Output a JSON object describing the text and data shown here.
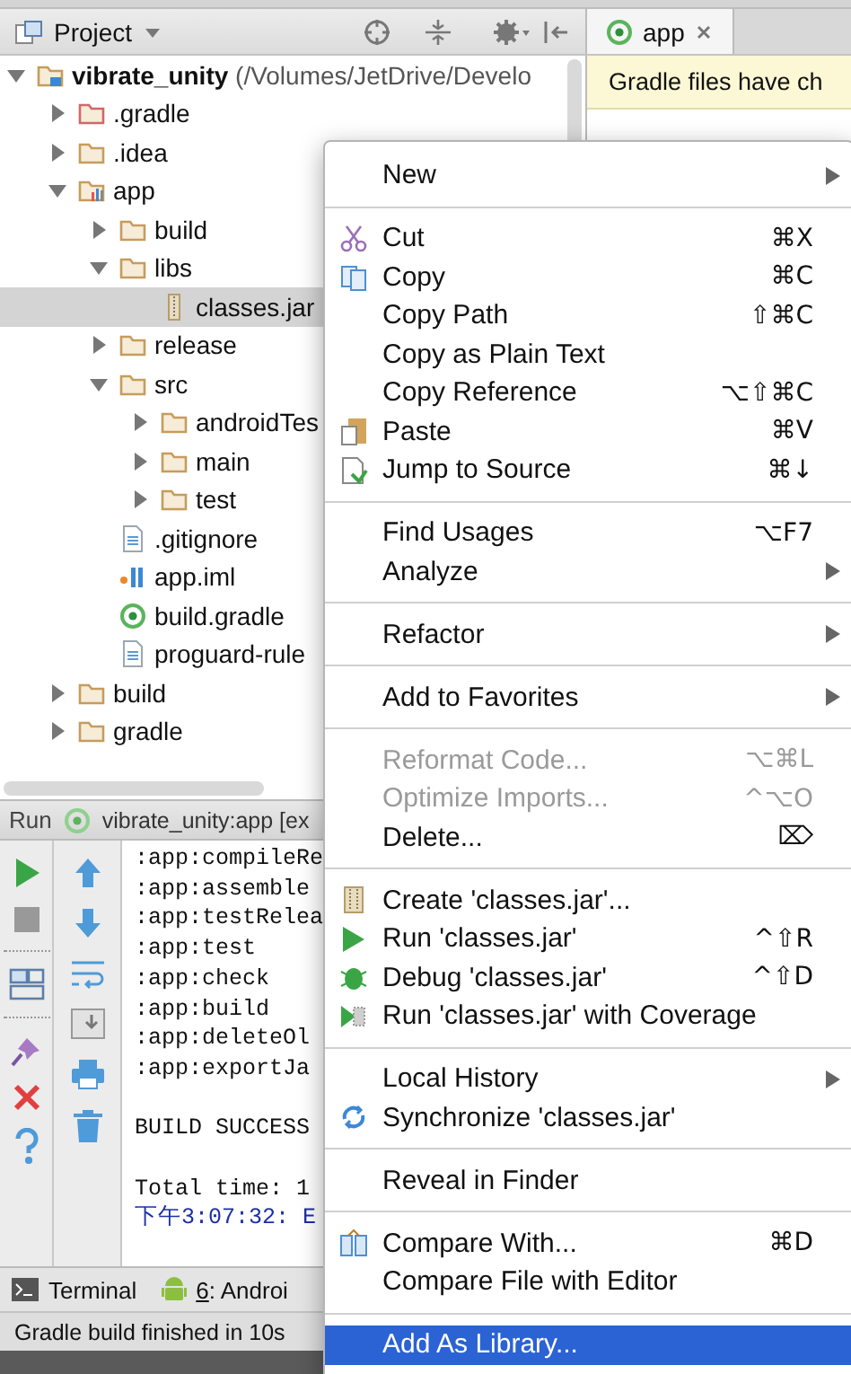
{
  "project_header": {
    "title": "Project"
  },
  "editor_tabs": [
    {
      "label": "app",
      "selected": true
    }
  ],
  "banner": "Gradle files have ch",
  "tree": [
    {
      "name": "vibrate_unity",
      "path": "(/Volumes/JetDrive/Develo",
      "kind": "module",
      "expanded": true,
      "selected": false,
      "children": [
        {
          "name": ".gradle",
          "kind": "excluded-folder",
          "expanded": false,
          "selected": false
        },
        {
          "name": ".idea",
          "kind": "folder",
          "expanded": false,
          "selected": false
        },
        {
          "name": "app",
          "kind": "module-folder",
          "expanded": true,
          "selected": false,
          "children": [
            {
              "name": "build",
              "kind": "folder",
              "expanded": false,
              "selected": false
            },
            {
              "name": "libs",
              "kind": "folder",
              "expanded": true,
              "selected": false,
              "children": [
                {
                  "name": "classes.jar",
                  "kind": "jar",
                  "selected": true
                }
              ]
            },
            {
              "name": "release",
              "kind": "folder",
              "expanded": false,
              "selected": false
            },
            {
              "name": "src",
              "kind": "folder",
              "expanded": true,
              "selected": false,
              "children": [
                {
                  "name": "androidTes",
                  "kind": "folder",
                  "expanded": false,
                  "selected": false
                },
                {
                  "name": "main",
                  "kind": "folder",
                  "expanded": false,
                  "selected": false
                },
                {
                  "name": "test",
                  "kind": "folder",
                  "expanded": false,
                  "selected": false
                }
              ]
            },
            {
              "name": ".gitignore",
              "kind": "text",
              "selected": false
            },
            {
              "name": "app.iml",
              "kind": "iml",
              "selected": false
            },
            {
              "name": "build.gradle",
              "kind": "gradle",
              "selected": false
            },
            {
              "name": "proguard-rule",
              "kind": "text",
              "selected": false
            }
          ]
        },
        {
          "name": "build",
          "kind": "folder",
          "expanded": false,
          "selected": false
        },
        {
          "name": "gradle",
          "kind": "folder",
          "expanded": false,
          "selected": false
        }
      ]
    }
  ],
  "run_panel": {
    "label": "Run",
    "config": "vibrate_unity:app [ex",
    "lines": [
      {
        "kind": "line",
        "text": ":app:compileRe"
      },
      {
        "kind": "line",
        "text": ":app:assemble"
      },
      {
        "kind": "line",
        "text": ":app:testRelea"
      },
      {
        "kind": "line",
        "text": ":app:test"
      },
      {
        "kind": "line",
        "text": ":app:check"
      },
      {
        "kind": "line",
        "text": ":app:build"
      },
      {
        "kind": "line",
        "text": ":app:deleteOl"
      },
      {
        "kind": "line",
        "text": ":app:exportJa"
      },
      {
        "kind": "block",
        "text": "BUILD SUCCESS"
      },
      {
        "kind": "block",
        "text": "Total time: 1"
      },
      {
        "kind": "event",
        "text": "下午3:07:32: E"
      }
    ]
  },
  "bottom_tabs": [
    {
      "label": "Terminal"
    },
    {
      "mnemonic": "6",
      "label": ": Androi"
    }
  ],
  "status_bar": "Gradle build finished in 10s",
  "context_menu": [
    {
      "kind": "item",
      "label": "New",
      "submenu": true,
      "disabled": false,
      "selected": false
    },
    {
      "kind": "separator"
    },
    {
      "kind": "item",
      "label": "Cut",
      "shortcut": "⌘X",
      "submenu": false,
      "disabled": false,
      "selected": false
    },
    {
      "kind": "item",
      "label": "Copy",
      "shortcut": "⌘C",
      "submenu": false,
      "disabled": false,
      "selected": false
    },
    {
      "kind": "item",
      "label": "Copy Path",
      "shortcut": "⇧⌘C",
      "submenu": false,
      "disabled": false,
      "selected": false
    },
    {
      "kind": "item",
      "label": "Copy as Plain Text",
      "submenu": false,
      "disabled": false,
      "selected": false
    },
    {
      "kind": "item",
      "label": "Copy Reference",
      "shortcut": "⌥⇧⌘C",
      "submenu": false,
      "disabled": false,
      "selected": false
    },
    {
      "kind": "item",
      "label": "Paste",
      "shortcut": "⌘V",
      "submenu": false,
      "disabled": false,
      "selected": false
    },
    {
      "kind": "item",
      "label": "Jump to Source",
      "shortcut": "⌘↓",
      "submenu": false,
      "disabled": false,
      "selected": false
    },
    {
      "kind": "separator"
    },
    {
      "kind": "item",
      "label": "Find Usages",
      "shortcut": "⌥F7",
      "submenu": false,
      "disabled": false,
      "selected": false
    },
    {
      "kind": "item",
      "label": "Analyze",
      "submenu": true,
      "disabled": false,
      "selected": false
    },
    {
      "kind": "separator"
    },
    {
      "kind": "item",
      "label": "Refactor",
      "submenu": true,
      "disabled": false,
      "selected": false
    },
    {
      "kind": "separator"
    },
    {
      "kind": "item",
      "label": "Add to Favorites",
      "submenu": true,
      "disabled": false,
      "selected": false
    },
    {
      "kind": "separator"
    },
    {
      "kind": "item",
      "label": "Reformat Code...",
      "shortcut": "⌥⌘L",
      "submenu": false,
      "disabled": true,
      "selected": false
    },
    {
      "kind": "item",
      "label": "Optimize Imports...",
      "shortcut": "^⌥O",
      "submenu": false,
      "disabled": true,
      "selected": false
    },
    {
      "kind": "item",
      "label": "Delete...",
      "shortcut": "⌦",
      "submenu": false,
      "disabled": false,
      "selected": false
    },
    {
      "kind": "separator"
    },
    {
      "kind": "item",
      "label": "Create 'classes.jar'...",
      "submenu": false,
      "disabled": false,
      "selected": false
    },
    {
      "kind": "item",
      "label": "Run 'classes.jar'",
      "shortcut": "^⇧R",
      "submenu": false,
      "disabled": false,
      "selected": false
    },
    {
      "kind": "item",
      "label": "Debug 'classes.jar'",
      "shortcut": "^⇧D",
      "submenu": false,
      "disabled": false,
      "selected": false
    },
    {
      "kind": "item",
      "label": "Run 'classes.jar' with Coverage",
      "submenu": false,
      "disabled": false,
      "selected": false
    },
    {
      "kind": "separator"
    },
    {
      "kind": "item",
      "label": "Local History",
      "submenu": true,
      "disabled": false,
      "selected": false
    },
    {
      "kind": "item",
      "label": "Synchronize 'classes.jar'",
      "submenu": false,
      "disabled": false,
      "selected": false
    },
    {
      "kind": "separator"
    },
    {
      "kind": "item",
      "label": "Reveal in Finder",
      "submenu": false,
      "disabled": false,
      "selected": false
    },
    {
      "kind": "separator"
    },
    {
      "kind": "item",
      "label": "Compare With...",
      "shortcut": "⌘D",
      "submenu": false,
      "disabled": false,
      "selected": false
    },
    {
      "kind": "item",
      "label": "Compare File with Editor",
      "submenu": false,
      "disabled": false,
      "selected": false
    },
    {
      "kind": "separator"
    },
    {
      "kind": "item",
      "label": "Add As Library...",
      "submenu": false,
      "disabled": false,
      "selected": true
    }
  ]
}
